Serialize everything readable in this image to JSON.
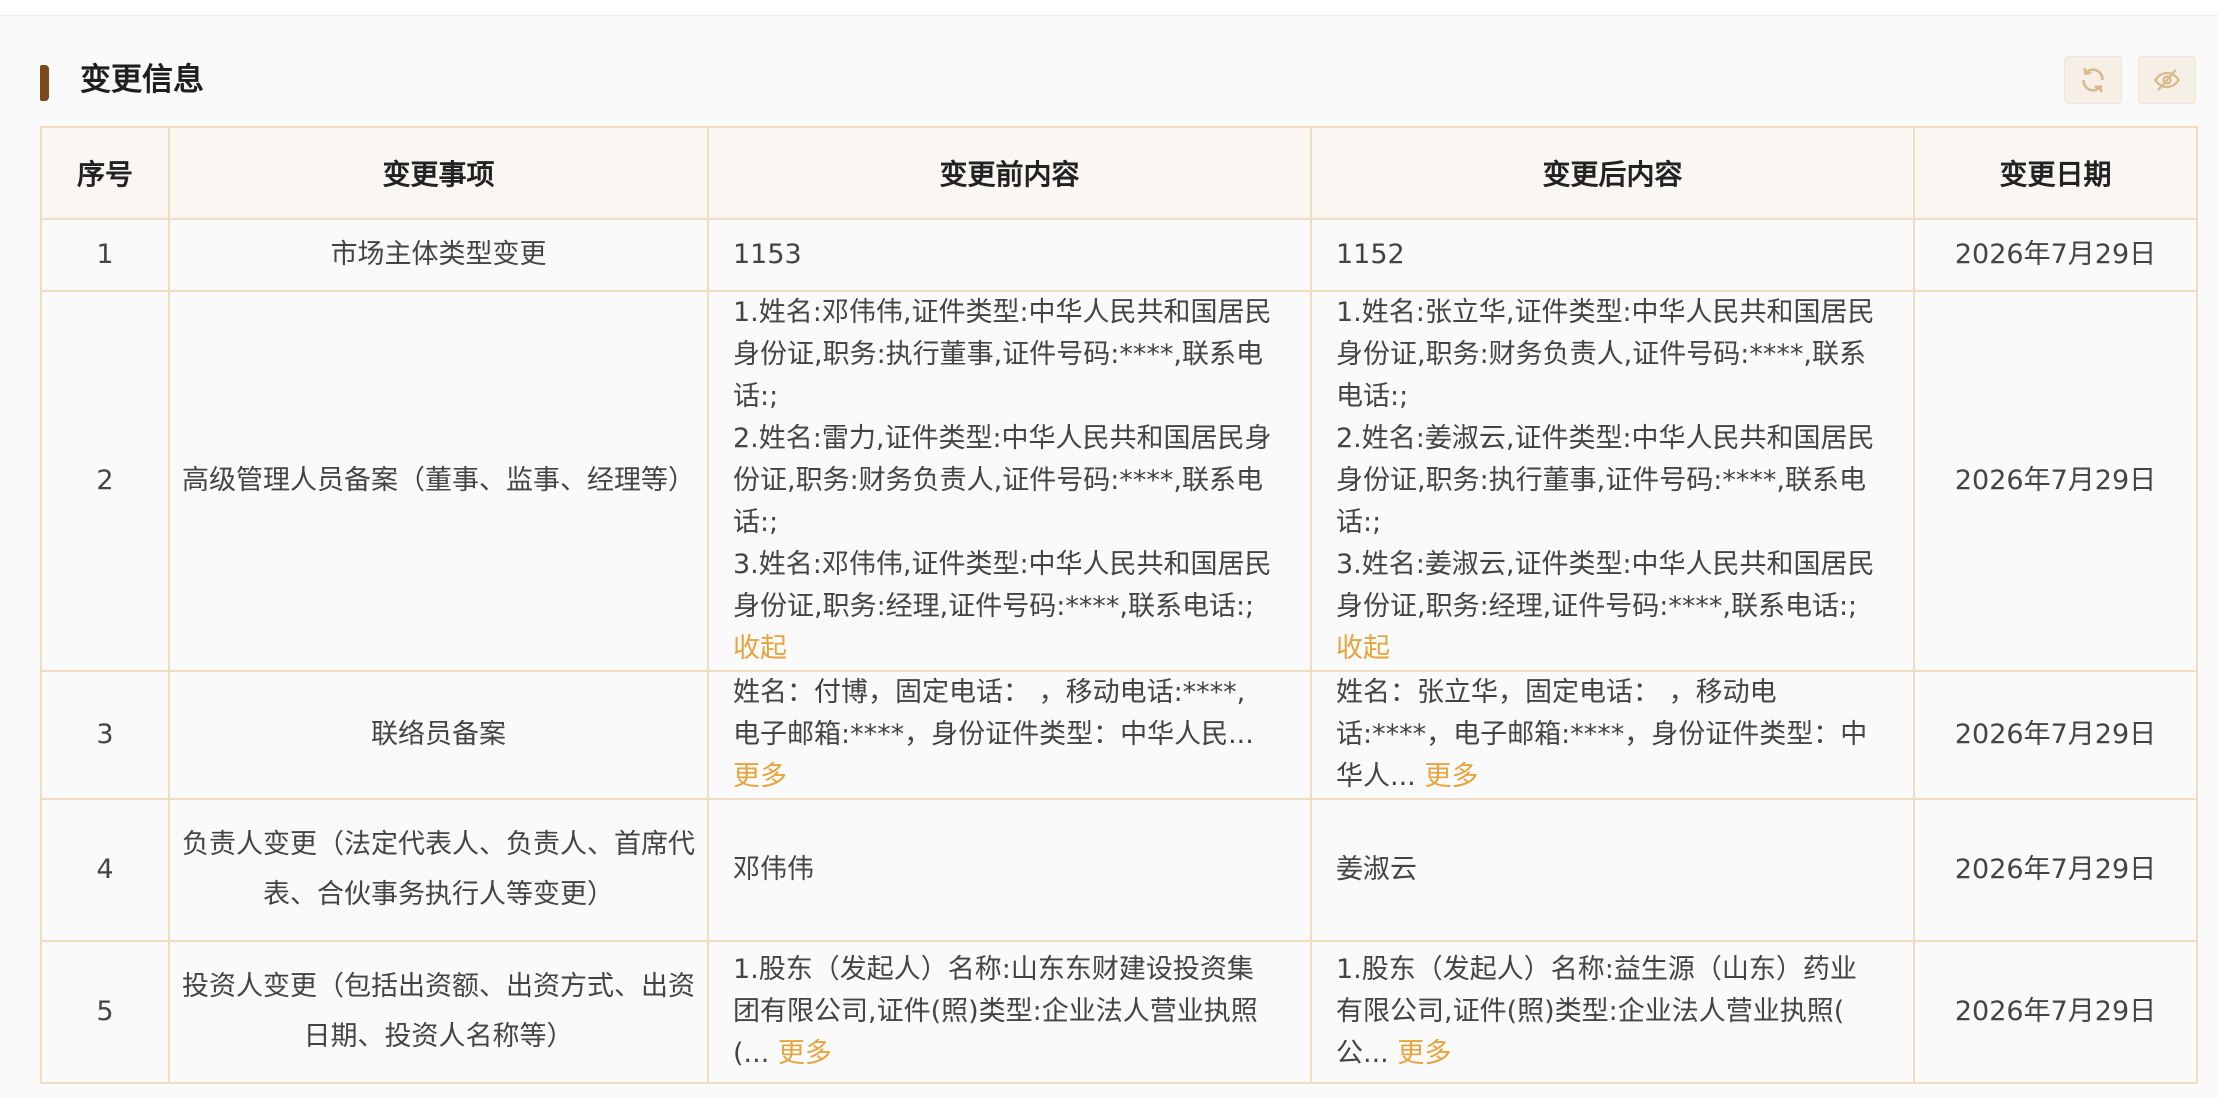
{
  "section": {
    "title": "变更信息"
  },
  "table": {
    "headers": {
      "index": "序号",
      "item": "变更事项",
      "before": "变更前内容",
      "after": "变更后内容",
      "date": "变更日期"
    },
    "rows": [
      {
        "index": "1",
        "item": "市场主体类型变更",
        "before_lines": [
          "1153"
        ],
        "after_lines": [
          "1152"
        ],
        "date": "2026年7月29日"
      },
      {
        "index": "2",
        "item": "高级管理人员备案（董事、监事、经理等）",
        "before_lines": [
          "1.姓名:邓伟伟,证件类型:中华人民共和国居民",
          "身份证,职务:执行董事,证件号码:****,联系电",
          "话:;",
          "2.姓名:雷力,证件类型:中华人民共和国居民身",
          "份证,职务:财务负责人,证件号码:****,联系电",
          "话:;",
          "3.姓名:邓伟伟,证件类型:中华人民共和国居民",
          "身份证,职务:经理,证件号码:****,联系电话:;"
        ],
        "before_link": "收起",
        "after_lines": [
          "1.姓名:张立华,证件类型:中华人民共和国居民",
          "身份证,职务:财务负责人,证件号码:****,联系",
          "电话:;",
          "2.姓名:姜淑云,证件类型:中华人民共和国居民",
          "身份证,职务:执行董事,证件号码:****,联系电",
          "话:;",
          "3.姓名:姜淑云,证件类型:中华人民共和国居民",
          "身份证,职务:经理,证件号码:****,联系电话:;"
        ],
        "after_link": "收起",
        "date": "2026年7月29日"
      },
      {
        "index": "3",
        "item": "联络员备案",
        "before_lines": [
          "姓名：付博，固定电话：  ，移动电话:****,",
          "电子邮箱:****，身份证件类型：中华人民..."
        ],
        "before_link": "更多",
        "after_lines": [
          "姓名：张立华，固定电话：  ，移动电",
          "话:****，电子邮箱:****，身份证件类型：中",
          "华人..."
        ],
        "after_link": "更多",
        "date": "2026年7月29日"
      },
      {
        "index": "4",
        "item_lines": [
          "负责人变更（法定代表人、负责人、首席代",
          "表、合伙事务执行人等变更）"
        ],
        "before_lines": [
          "邓伟伟"
        ],
        "after_lines": [
          "姜淑云"
        ],
        "date": "2026年7月29日"
      },
      {
        "index": "5",
        "item_lines": [
          "投资人变更（包括出资额、出资方式、出资",
          "日期、投资人名称等）"
        ],
        "before_lines": [
          "1.股东（发起人）名称:山东东财建设投资集",
          "团有限公司,证件(照)类型:企业法人营业执照",
          "(..."
        ],
        "before_link": "更多",
        "after_lines": [
          "1.股东（发起人）名称:益生源（山东）药业",
          "有限公司,证件(照)类型:企业法人营业执照(",
          "公..."
        ],
        "after_link": "更多",
        "date": "2026年7月29日"
      }
    ]
  },
  "icons": {
    "refresh": "refresh-icon",
    "hide": "eye-off-icon"
  },
  "colors": {
    "accent": "#7a4a1c",
    "link": "#e8a43c",
    "border": "#f0dcc0",
    "button_bg": "#f5efe6"
  }
}
